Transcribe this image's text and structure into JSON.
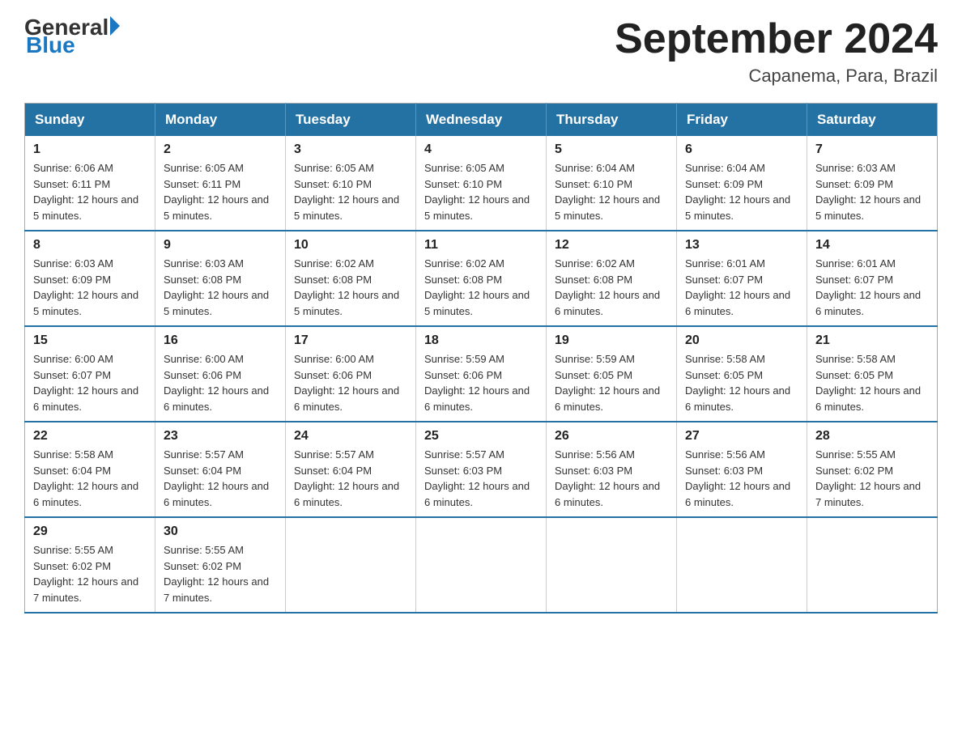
{
  "logo": {
    "text_general": "General",
    "text_blue": "Blue",
    "triangle": "▶"
  },
  "title": "September 2024",
  "subtitle": "Capanema, Para, Brazil",
  "days_of_week": [
    "Sunday",
    "Monday",
    "Tuesday",
    "Wednesday",
    "Thursday",
    "Friday",
    "Saturday"
  ],
  "weeks": [
    [
      {
        "day": "1",
        "sunrise": "6:06 AM",
        "sunset": "6:11 PM",
        "daylight": "12 hours and 5 minutes."
      },
      {
        "day": "2",
        "sunrise": "6:05 AM",
        "sunset": "6:11 PM",
        "daylight": "12 hours and 5 minutes."
      },
      {
        "day": "3",
        "sunrise": "6:05 AM",
        "sunset": "6:10 PM",
        "daylight": "12 hours and 5 minutes."
      },
      {
        "day": "4",
        "sunrise": "6:05 AM",
        "sunset": "6:10 PM",
        "daylight": "12 hours and 5 minutes."
      },
      {
        "day": "5",
        "sunrise": "6:04 AM",
        "sunset": "6:10 PM",
        "daylight": "12 hours and 5 minutes."
      },
      {
        "day": "6",
        "sunrise": "6:04 AM",
        "sunset": "6:09 PM",
        "daylight": "12 hours and 5 minutes."
      },
      {
        "day": "7",
        "sunrise": "6:03 AM",
        "sunset": "6:09 PM",
        "daylight": "12 hours and 5 minutes."
      }
    ],
    [
      {
        "day": "8",
        "sunrise": "6:03 AM",
        "sunset": "6:09 PM",
        "daylight": "12 hours and 5 minutes."
      },
      {
        "day": "9",
        "sunrise": "6:03 AM",
        "sunset": "6:08 PM",
        "daylight": "12 hours and 5 minutes."
      },
      {
        "day": "10",
        "sunrise": "6:02 AM",
        "sunset": "6:08 PM",
        "daylight": "12 hours and 5 minutes."
      },
      {
        "day": "11",
        "sunrise": "6:02 AM",
        "sunset": "6:08 PM",
        "daylight": "12 hours and 5 minutes."
      },
      {
        "day": "12",
        "sunrise": "6:02 AM",
        "sunset": "6:08 PM",
        "daylight": "12 hours and 6 minutes."
      },
      {
        "day": "13",
        "sunrise": "6:01 AM",
        "sunset": "6:07 PM",
        "daylight": "12 hours and 6 minutes."
      },
      {
        "day": "14",
        "sunrise": "6:01 AM",
        "sunset": "6:07 PM",
        "daylight": "12 hours and 6 minutes."
      }
    ],
    [
      {
        "day": "15",
        "sunrise": "6:00 AM",
        "sunset": "6:07 PM",
        "daylight": "12 hours and 6 minutes."
      },
      {
        "day": "16",
        "sunrise": "6:00 AM",
        "sunset": "6:06 PM",
        "daylight": "12 hours and 6 minutes."
      },
      {
        "day": "17",
        "sunrise": "6:00 AM",
        "sunset": "6:06 PM",
        "daylight": "12 hours and 6 minutes."
      },
      {
        "day": "18",
        "sunrise": "5:59 AM",
        "sunset": "6:06 PM",
        "daylight": "12 hours and 6 minutes."
      },
      {
        "day": "19",
        "sunrise": "5:59 AM",
        "sunset": "6:05 PM",
        "daylight": "12 hours and 6 minutes."
      },
      {
        "day": "20",
        "sunrise": "5:58 AM",
        "sunset": "6:05 PM",
        "daylight": "12 hours and 6 minutes."
      },
      {
        "day": "21",
        "sunrise": "5:58 AM",
        "sunset": "6:05 PM",
        "daylight": "12 hours and 6 minutes."
      }
    ],
    [
      {
        "day": "22",
        "sunrise": "5:58 AM",
        "sunset": "6:04 PM",
        "daylight": "12 hours and 6 minutes."
      },
      {
        "day": "23",
        "sunrise": "5:57 AM",
        "sunset": "6:04 PM",
        "daylight": "12 hours and 6 minutes."
      },
      {
        "day": "24",
        "sunrise": "5:57 AM",
        "sunset": "6:04 PM",
        "daylight": "12 hours and 6 minutes."
      },
      {
        "day": "25",
        "sunrise": "5:57 AM",
        "sunset": "6:03 PM",
        "daylight": "12 hours and 6 minutes."
      },
      {
        "day": "26",
        "sunrise": "5:56 AM",
        "sunset": "6:03 PM",
        "daylight": "12 hours and 6 minutes."
      },
      {
        "day": "27",
        "sunrise": "5:56 AM",
        "sunset": "6:03 PM",
        "daylight": "12 hours and 6 minutes."
      },
      {
        "day": "28",
        "sunrise": "5:55 AM",
        "sunset": "6:02 PM",
        "daylight": "12 hours and 7 minutes."
      }
    ],
    [
      {
        "day": "29",
        "sunrise": "5:55 AM",
        "sunset": "6:02 PM",
        "daylight": "12 hours and 7 minutes."
      },
      {
        "day": "30",
        "sunrise": "5:55 AM",
        "sunset": "6:02 PM",
        "daylight": "12 hours and 7 minutes."
      },
      null,
      null,
      null,
      null,
      null
    ]
  ]
}
